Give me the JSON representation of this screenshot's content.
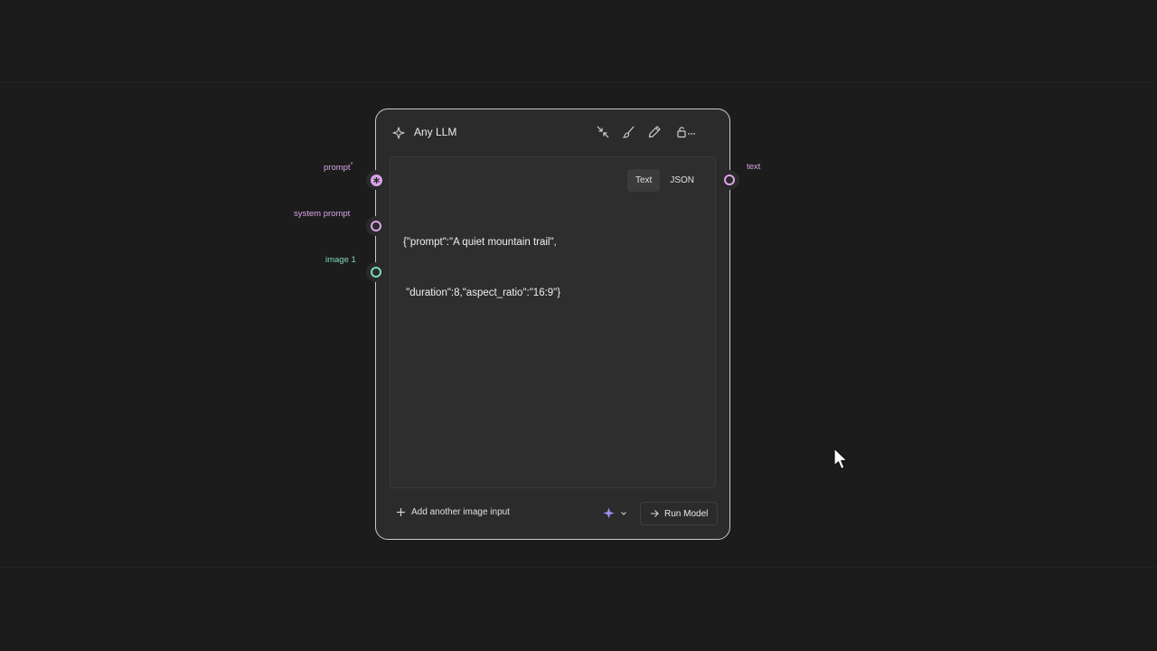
{
  "node": {
    "title": "Any LLM",
    "tabs": [
      "Text",
      "JSON"
    ],
    "active_tab": "Text",
    "content_line1": "{\"prompt\":\"A quiet mountain trail\",",
    "content_line2": " \"duration\":8,\"aspect_ratio\":\"16:9\"}",
    "add_input_label": "Add another image input",
    "run_label": "Run Model"
  },
  "ports": {
    "inputs": [
      {
        "label": "prompt",
        "required_mark": "*",
        "color": "#d9a3ea"
      },
      {
        "label": "system prompt",
        "color": "#d9a3ea"
      },
      {
        "label": "image 1",
        "color": "#7fd9b4"
      }
    ],
    "outputs": [
      {
        "label": "text",
        "color": "#d9a3ea"
      }
    ]
  },
  "colors": {
    "text_port": "#d9a3ea",
    "image_port": "#7fd9b4",
    "sparkle": "#9b8cf0",
    "node_border": "#c9c9c9"
  }
}
